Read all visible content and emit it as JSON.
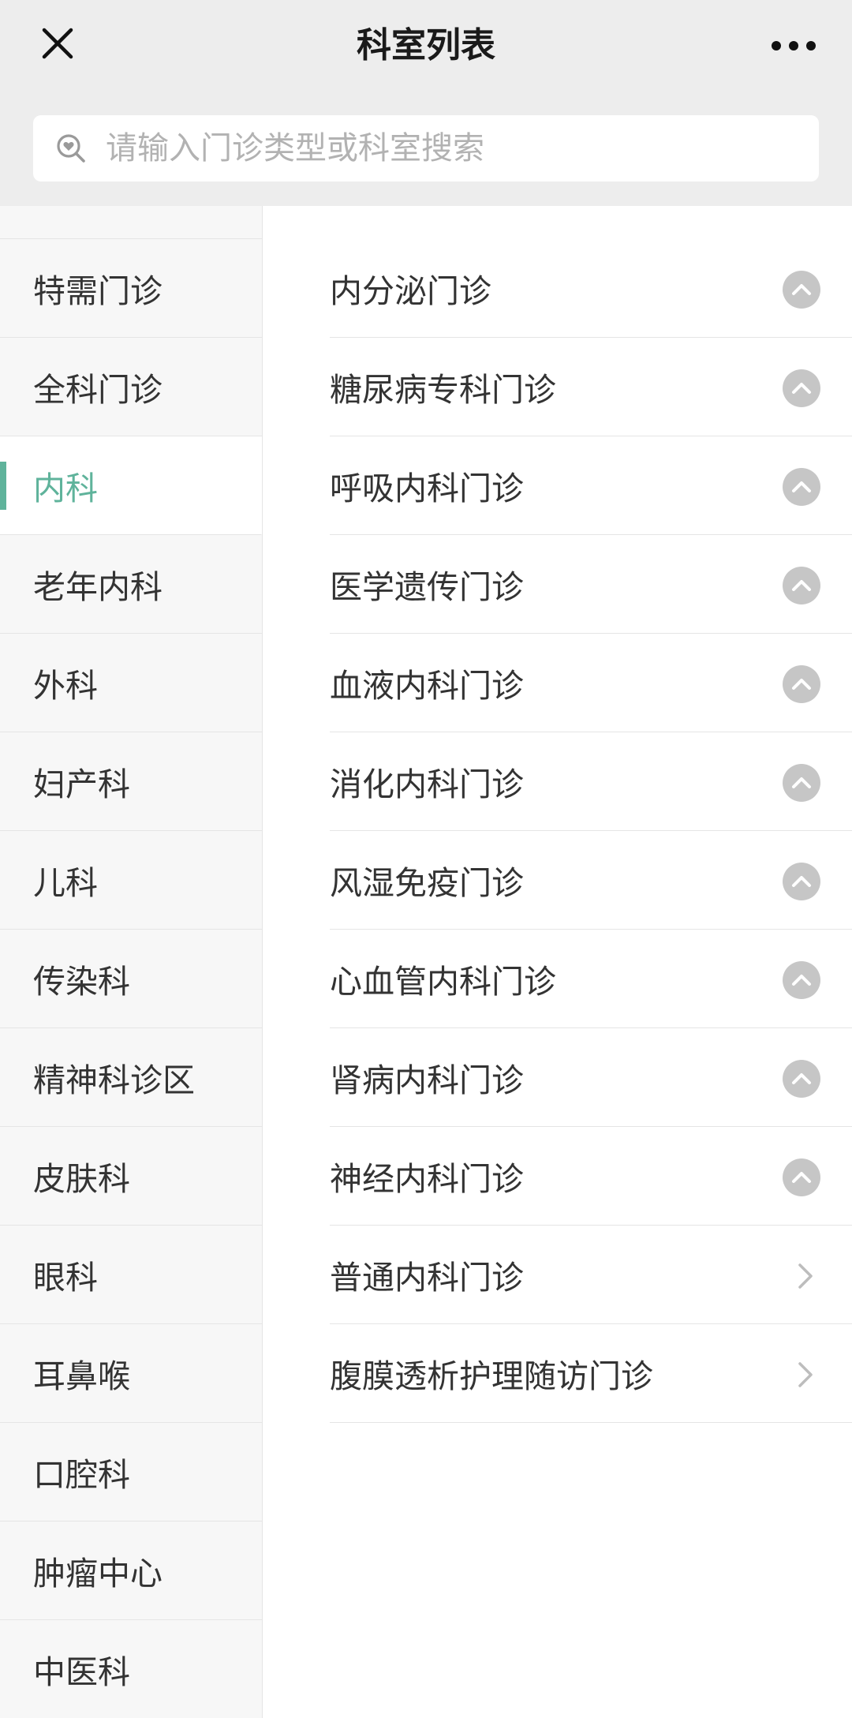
{
  "navbar": {
    "title": "科室列表",
    "close_icon": "close-icon",
    "more_icon": "more-dots-icon"
  },
  "search": {
    "placeholder": "请输入门诊类型或科室搜索",
    "icon": "search-heart-icon"
  },
  "colors": {
    "accent": "#5fb39b",
    "navbar_bg": "#ededed",
    "sidebar_bg": "#f7f7f7"
  },
  "sidebar": {
    "items": [
      {
        "label": "特需门诊",
        "active": false
      },
      {
        "label": "全科门诊",
        "active": false
      },
      {
        "label": "内科",
        "active": true
      },
      {
        "label": "老年内科",
        "active": false
      },
      {
        "label": "外科",
        "active": false
      },
      {
        "label": "妇产科",
        "active": false
      },
      {
        "label": "儿科",
        "active": false
      },
      {
        "label": "传染科",
        "active": false
      },
      {
        "label": "精神科诊区",
        "active": false
      },
      {
        "label": "皮肤科",
        "active": false
      },
      {
        "label": "眼科",
        "active": false
      },
      {
        "label": "耳鼻喉",
        "active": false
      },
      {
        "label": "口腔科",
        "active": false
      },
      {
        "label": "肿瘤中心",
        "active": false
      },
      {
        "label": "中医科",
        "active": false
      }
    ]
  },
  "clinics": {
    "items": [
      {
        "label": "内分泌门诊",
        "icon": "chevron-up-circle-icon"
      },
      {
        "label": "糖尿病专科门诊",
        "icon": "chevron-up-circle-icon"
      },
      {
        "label": "呼吸内科门诊",
        "icon": "chevron-up-circle-icon"
      },
      {
        "label": "医学遗传门诊",
        "icon": "chevron-up-circle-icon"
      },
      {
        "label": "血液内科门诊",
        "icon": "chevron-up-circle-icon"
      },
      {
        "label": "消化内科门诊",
        "icon": "chevron-up-circle-icon"
      },
      {
        "label": "风湿免疫门诊",
        "icon": "chevron-up-circle-icon"
      },
      {
        "label": "心血管内科门诊",
        "icon": "chevron-up-circle-icon"
      },
      {
        "label": "肾病内科门诊",
        "icon": "chevron-up-circle-icon"
      },
      {
        "label": "神经内科门诊",
        "icon": "chevron-up-circle-icon"
      },
      {
        "label": "普通内科门诊",
        "icon": "chevron-right-icon"
      },
      {
        "label": "腹膜透析护理随访门诊",
        "icon": "chevron-right-icon"
      }
    ]
  }
}
